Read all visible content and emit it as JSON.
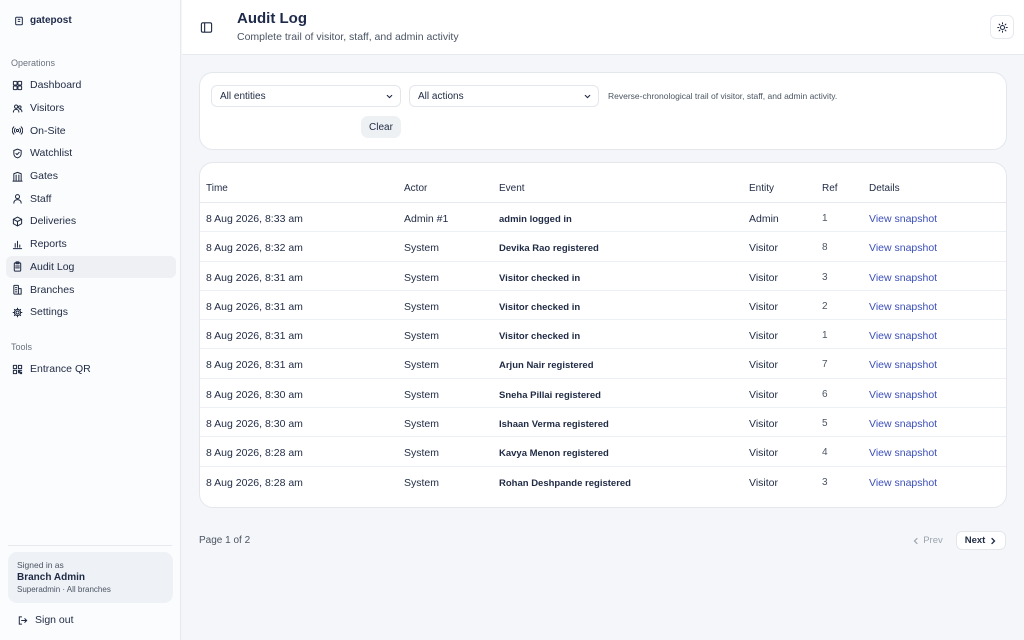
{
  "brand": {
    "name": "gatepost"
  },
  "sidebar": {
    "operations_label": "Operations",
    "operations": [
      {
        "label": "Dashboard",
        "icon": "dashboard-icon"
      },
      {
        "label": "Visitors",
        "icon": "users-icon"
      },
      {
        "label": "On-Site",
        "icon": "broadcast-icon"
      },
      {
        "label": "Watchlist",
        "icon": "shield-icon"
      },
      {
        "label": "Gates",
        "icon": "gate-icon"
      },
      {
        "label": "Staff",
        "icon": "user-icon"
      },
      {
        "label": "Deliveries",
        "icon": "package-icon"
      },
      {
        "label": "Reports",
        "icon": "bar-chart-icon"
      },
      {
        "label": "Audit Log",
        "icon": "clipboard-icon",
        "active": true
      },
      {
        "label": "Branches",
        "icon": "building-icon"
      },
      {
        "label": "Settings",
        "icon": "gear-icon"
      }
    ],
    "tools_label": "Tools",
    "tools": [
      {
        "label": "Entrance QR",
        "icon": "qr-icon"
      }
    ],
    "account": {
      "signed_in_label": "Signed in as",
      "name": "Branch Admin",
      "role": "Superadmin · All branches"
    },
    "signout_label": "Sign out"
  },
  "header": {
    "title": "Audit Log",
    "subtitle": "Complete trail of visitor, staff, and admin activity"
  },
  "filters": {
    "entity_value": "All entities",
    "action_value": "All actions",
    "note": "Reverse-chronological trail of visitor, staff, and admin activity.",
    "clear_label": "Clear"
  },
  "table": {
    "columns": [
      "Time",
      "Actor",
      "Event",
      "Entity",
      "Ref",
      "Details"
    ],
    "rows": [
      {
        "time": "8 Aug 2026, 8:33 am",
        "actor": "Admin #1",
        "event": "admin logged in",
        "entity": "Admin",
        "ref": "1",
        "details": "View snapshot"
      },
      {
        "time": "8 Aug 2026, 8:32 am",
        "actor": "System",
        "event": "Devika Rao registered",
        "entity": "Visitor",
        "ref": "8",
        "details": "View snapshot"
      },
      {
        "time": "8 Aug 2026, 8:31 am",
        "actor": "System",
        "event": "Visitor checked in",
        "entity": "Visitor",
        "ref": "3",
        "details": "View snapshot"
      },
      {
        "time": "8 Aug 2026, 8:31 am",
        "actor": "System",
        "event": "Visitor checked in",
        "entity": "Visitor",
        "ref": "2",
        "details": "View snapshot"
      },
      {
        "time": "8 Aug 2026, 8:31 am",
        "actor": "System",
        "event": "Visitor checked in",
        "entity": "Visitor",
        "ref": "1",
        "details": "View snapshot"
      },
      {
        "time": "8 Aug 2026, 8:31 am",
        "actor": "System",
        "event": "Arjun Nair registered",
        "entity": "Visitor",
        "ref": "7",
        "details": "View snapshot"
      },
      {
        "time": "8 Aug 2026, 8:30 am",
        "actor": "System",
        "event": "Sneha Pillai registered",
        "entity": "Visitor",
        "ref": "6",
        "details": "View snapshot"
      },
      {
        "time": "8 Aug 2026, 8:30 am",
        "actor": "System",
        "event": "Ishaan Verma registered",
        "entity": "Visitor",
        "ref": "5",
        "details": "View snapshot"
      },
      {
        "time": "8 Aug 2026, 8:28 am",
        "actor": "System",
        "event": "Kavya Menon registered",
        "entity": "Visitor",
        "ref": "4",
        "details": "View snapshot"
      },
      {
        "time": "8 Aug 2026, 8:28 am",
        "actor": "System",
        "event": "Rohan Deshpande registered",
        "entity": "Visitor",
        "ref": "3",
        "details": "View snapshot"
      }
    ]
  },
  "pagination": {
    "info": "Page 1 of 2",
    "prev_label": "Prev",
    "next_label": "Next"
  },
  "colors": {
    "accent_link": "#3b4fb8",
    "brand_text": "#1e2a4a",
    "background": "#f4f6f9"
  }
}
